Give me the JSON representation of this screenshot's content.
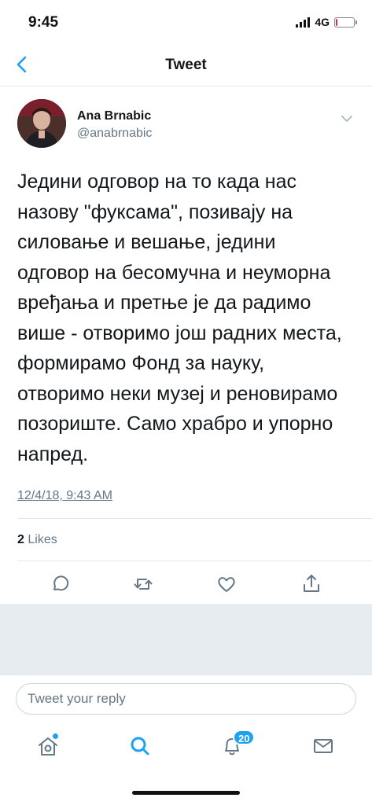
{
  "status_bar": {
    "time": "9:45",
    "network": "4G",
    "battery_level": 0.1,
    "battery_color": "#e0245e"
  },
  "nav": {
    "title": "Tweet",
    "back_icon": "chevron-left-icon"
  },
  "tweet": {
    "author_name": "Ana Brnabic",
    "author_handle": "@anabrnabic",
    "text": "Једини одговор на то када нас\nназову \"фуксама\", позивају на\nсиловање и вешање, једини\nодговор на бесомучна и неуморна\nвређања и претње је да радимо\nвише - отворимо још радних места,\nформирамо Фонд за науку,\nотворимо неки музеј и реновирамо\nпозориште. Само храбро и упорно\nнапред.",
    "timestamp": "12/4/18, 9:43 AM",
    "likes_count": "2",
    "likes_label": "Likes"
  },
  "actions": {
    "reply_icon": "reply-icon",
    "retweet_icon": "retweet-icon",
    "like_icon": "heart-icon",
    "share_icon": "share-icon"
  },
  "reply": {
    "placeholder": "Tweet your reply"
  },
  "tab_bar": {
    "notifications_badge": "20",
    "icons": [
      "home-icon",
      "search-icon",
      "bell-icon",
      "mail-icon"
    ]
  },
  "colors": {
    "accent": "#1da1f2",
    "text_secondary": "#657786",
    "divider": "#e1e8ed",
    "gray_background": "#e6ecf0"
  }
}
